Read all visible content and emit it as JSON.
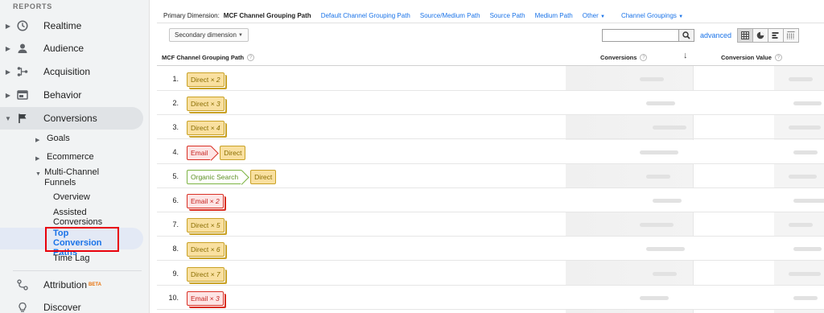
{
  "sidebar": {
    "heading": "REPORTS",
    "items": [
      {
        "label": "Realtime",
        "icon": "clock-icon"
      },
      {
        "label": "Audience",
        "icon": "person-icon"
      },
      {
        "label": "Acquisition",
        "icon": "acquisition-icon"
      },
      {
        "label": "Behavior",
        "icon": "behavior-icon"
      },
      {
        "label": "Conversions",
        "icon": "flag-icon"
      }
    ],
    "conversions_children": {
      "goals": "Goals",
      "ecommerce": "Ecommerce",
      "mcf": "Multi-Channel Funnels",
      "mcf_children": [
        "Overview",
        "Assisted Conversions",
        "Top Conversion Paths",
        "Time Lag"
      ]
    },
    "attribution": "Attribution",
    "attribution_badge": "BETA",
    "discover": "Discover"
  },
  "dimension_bar": {
    "label": "Primary Dimension:",
    "current": "MCF Channel Grouping Path",
    "links": [
      "Default Channel Grouping Path",
      "Source/Medium Path",
      "Source Path",
      "Medium Path"
    ],
    "other": "Other",
    "channel_groupings": "Channel Groupings"
  },
  "toolbar": {
    "secondary_dimension": "Secondary dimension",
    "search_placeholder": "",
    "advanced": "advanced"
  },
  "table": {
    "headers": {
      "path": "MCF Channel Grouping Path",
      "conversions": "Conversions",
      "conversion_value": "Conversion Value"
    },
    "rows": [
      {
        "num": "1.",
        "steps": [
          {
            "label": "Direct",
            "mult": "× 2",
            "type": "direct"
          }
        ]
      },
      {
        "num": "2.",
        "steps": [
          {
            "label": "Direct",
            "mult": "× 3",
            "type": "direct"
          }
        ]
      },
      {
        "num": "3.",
        "steps": [
          {
            "label": "Direct",
            "mult": "× 4",
            "type": "direct"
          }
        ]
      },
      {
        "num": "4.",
        "steps": [
          {
            "label": "Email",
            "mult": "",
            "type": "email"
          },
          {
            "label": "Direct",
            "mult": "",
            "type": "direct"
          }
        ]
      },
      {
        "num": "5.",
        "steps": [
          {
            "label": "Organic Search",
            "mult": "",
            "type": "organic"
          },
          {
            "label": "Direct",
            "mult": "",
            "type": "direct"
          }
        ]
      },
      {
        "num": "6.",
        "steps": [
          {
            "label": "Email",
            "mult": "× 2",
            "type": "email"
          }
        ]
      },
      {
        "num": "7.",
        "steps": [
          {
            "label": "Direct",
            "mult": "× 5",
            "type": "direct"
          }
        ]
      },
      {
        "num": "8.",
        "steps": [
          {
            "label": "Direct",
            "mult": "× 6",
            "type": "direct"
          }
        ]
      },
      {
        "num": "9.",
        "steps": [
          {
            "label": "Direct",
            "mult": "× 7",
            "type": "direct"
          }
        ]
      },
      {
        "num": "10.",
        "steps": [
          {
            "label": "Email",
            "mult": "× 3",
            "type": "email"
          }
        ]
      }
    ]
  },
  "colors": {
    "accent": "#1a73e8",
    "highlight_border": "#e8000b",
    "direct_fill": "#f9e0a0",
    "email_fill": "#fde4e4",
    "organic_border": "#7cb342"
  }
}
